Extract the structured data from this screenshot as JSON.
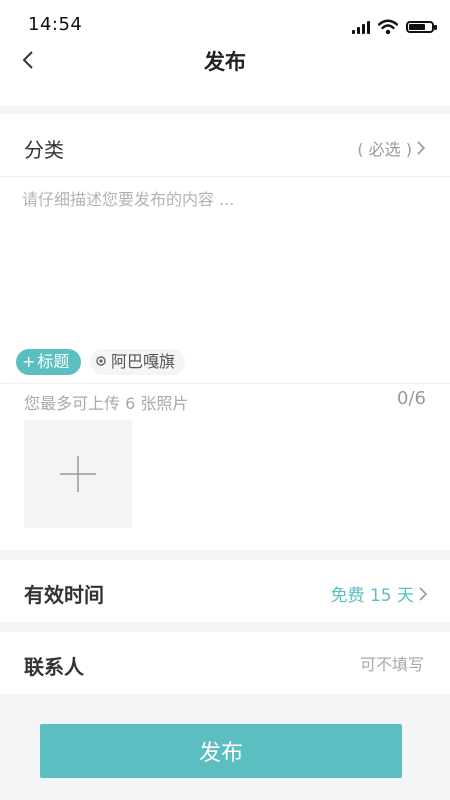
{
  "status_bar": {
    "time": "14:54"
  },
  "header": {
    "title": "发布"
  },
  "category": {
    "label": "分类",
    "hint": "( 必选 )"
  },
  "description": {
    "placeholder": "请仔细描述您要发布的内容 ..."
  },
  "tags": {
    "title_tag": {
      "icon": "+",
      "label": "标题"
    },
    "location_tag": {
      "label": "阿巴嘎旗"
    }
  },
  "upload": {
    "hint": "您最多可上传 6 张照片",
    "count": "0/6"
  },
  "validity": {
    "label": "有效时间",
    "value": "免费 15 天"
  },
  "contact": {
    "label": "联系人",
    "placeholder": "可不填写"
  },
  "submit": {
    "label": "发布"
  },
  "colors": {
    "accent": "#5bbfc1",
    "background": "#f4f5f7"
  },
  "icons": [
    "back-arrow-icon",
    "signal-icon",
    "wifi-icon",
    "battery-icon",
    "chevron-right-icon",
    "location-pin-icon",
    "plus-icon"
  ]
}
